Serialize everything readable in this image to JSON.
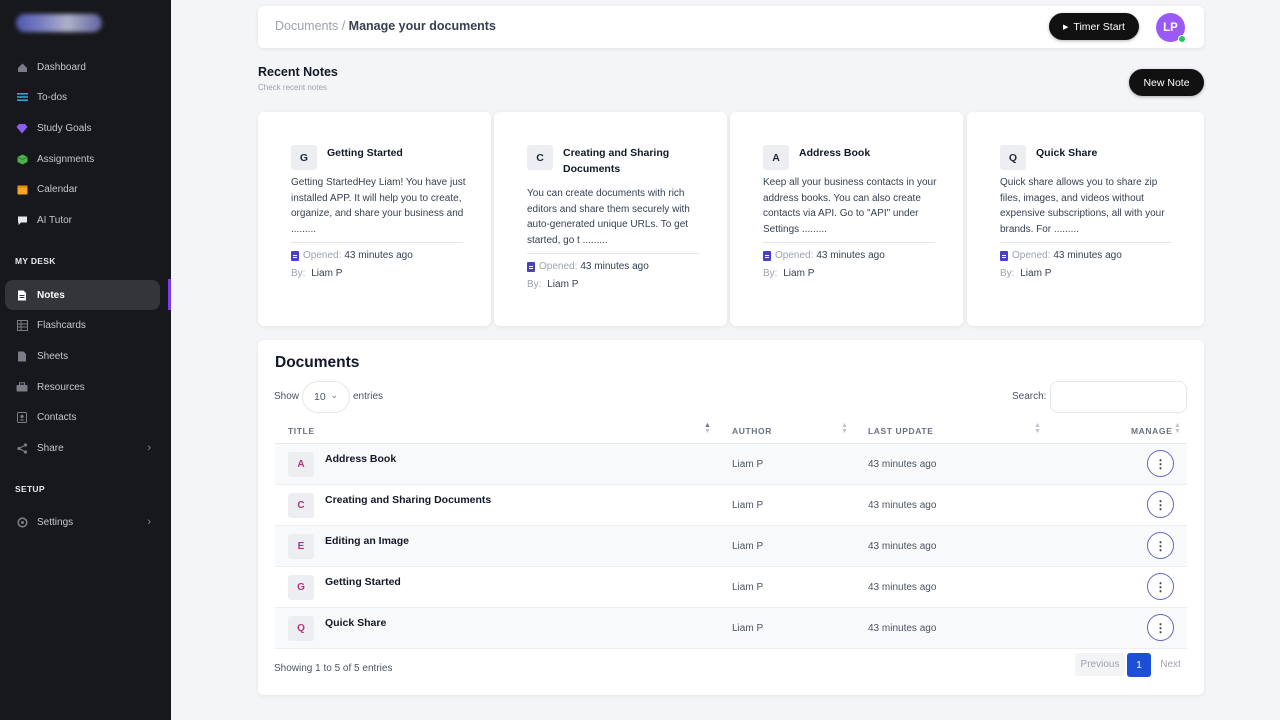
{
  "sidebar": {
    "items": [
      {
        "label": "Dashboard",
        "icon": "dashboard-icon"
      },
      {
        "label": "To-dos",
        "icon": "list-icon"
      },
      {
        "label": "Study Goals",
        "icon": "diamond-icon"
      },
      {
        "label": "Assignments",
        "icon": "cube-icon"
      },
      {
        "label": "Calendar",
        "icon": "calendar-icon"
      },
      {
        "label": "AI Tutor",
        "icon": "chat-icon"
      }
    ],
    "section_my_desk": "MY DESK",
    "desk_items": [
      {
        "label": "Notes",
        "icon": "note-icon",
        "active": true
      },
      {
        "label": "Flashcards",
        "icon": "flashcards-icon"
      },
      {
        "label": "Sheets",
        "icon": "sheets-icon"
      },
      {
        "label": "Resources",
        "icon": "resources-icon"
      },
      {
        "label": "Contacts",
        "icon": "contacts-icon"
      },
      {
        "label": "Share",
        "icon": "share-icon",
        "has_submenu": true
      }
    ],
    "section_setup": "SETUP",
    "setup_items": [
      {
        "label": "Settings",
        "icon": "gear-icon",
        "has_submenu": true
      }
    ]
  },
  "header": {
    "breadcrumb_parent": "Documents /",
    "breadcrumb_current": "Manage your documents",
    "timer_label": "Timer Start",
    "avatar_initials": "LP"
  },
  "recent": {
    "title": "Recent Notes",
    "subtitle": "Check recent notes",
    "new_note_label": "New Note",
    "opened_label": "Opened:",
    "by_label": "By:",
    "cards": [
      {
        "letter": "G",
        "title": "Getting Started",
        "body": "Getting StartedHey Liam! You have just installed APP. It will help you to create, organize, and share your business and .........",
        "opened": "43 minutes ago",
        "by": "Liam P"
      },
      {
        "letter": "C",
        "title": "Creating and Sharing Documents",
        "body": "You can create documents with rich editors and share them securely with auto-generated unique URLs. To get started, go t .........",
        "opened": "43 minutes ago",
        "by": "Liam P"
      },
      {
        "letter": "A",
        "title": "Address Book",
        "body": "Keep all your business contacts in your address books. You can also create contacts via API. Go to \"API\" under Settings .........",
        "opened": "43 minutes ago",
        "by": "Liam P"
      },
      {
        "letter": "Q",
        "title": "Quick Share",
        "body": "Quick share allows you to share zip files, images, and videos without expensive subscriptions, all with your brands. For .........",
        "opened": "43 minutes ago",
        "by": "Liam P"
      }
    ]
  },
  "documents": {
    "title": "Documents",
    "show_label": "Show",
    "entries_value": "10",
    "entries_label": "entries",
    "search_label": "Search:",
    "search_placeholder": "",
    "columns": [
      "TITLE",
      "AUTHOR",
      "LAST UPDATE",
      "MANAGE"
    ],
    "rows": [
      {
        "letter": "A",
        "title": "Address Book",
        "author": "Liam P",
        "updated": "43 minutes ago"
      },
      {
        "letter": "C",
        "title": "Creating and Sharing Documents",
        "author": "Liam P",
        "updated": "43 minutes ago"
      },
      {
        "letter": "E",
        "title": "Editing an Image",
        "author": "Liam P",
        "updated": "43 minutes ago"
      },
      {
        "letter": "G",
        "title": "Getting Started",
        "author": "Liam P",
        "updated": "43 minutes ago"
      },
      {
        "letter": "Q",
        "title": "Quick Share",
        "author": "Liam P",
        "updated": "43 minutes ago"
      }
    ],
    "showing_text": "Showing 1 to 5 of 5 entries",
    "pagination": {
      "prev": "Previous",
      "current": "1",
      "next": "Next"
    }
  },
  "colors": {
    "sidebar_bg": "#17181c",
    "accent_purple": "#7c3aed",
    "avatar": "#9b59f6",
    "pagination_active": "#1d4ed8",
    "letter_pink": "#b0367d"
  }
}
